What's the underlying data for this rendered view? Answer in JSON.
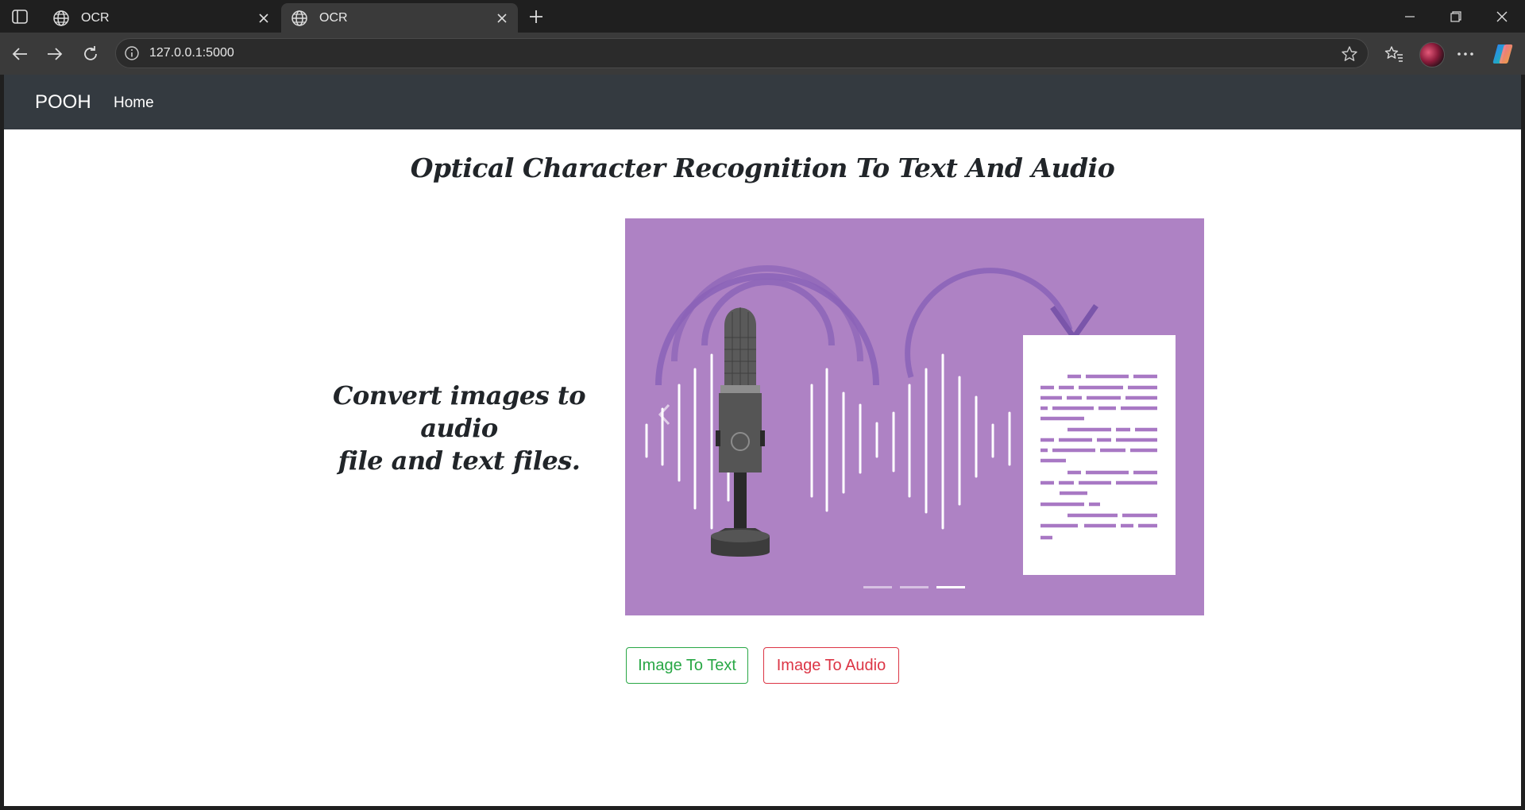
{
  "browser": {
    "tabs": [
      {
        "title": "OCR",
        "active": false
      },
      {
        "title": "OCR",
        "active": true
      }
    ],
    "url": "127.0.0.1:5000",
    "icons": [
      "tab-actions-icon",
      "globe-icon",
      "close-icon",
      "new-tab-icon",
      "minimize-icon",
      "restore-icon",
      "close-window-icon",
      "back-icon",
      "forward-icon",
      "refresh-icon",
      "info-icon",
      "star-icon",
      "favorites-icon",
      "profile-avatar",
      "more-icon",
      "copilot-icon"
    ]
  },
  "navbar": {
    "brand": "POOH",
    "links": [
      {
        "label": "Home"
      }
    ],
    "background": "#343a40"
  },
  "main": {
    "title": "Optical Character Recognition To Text And Audio",
    "tagline_line1": "Convert images to audio",
    "tagline_line2": "file and text files."
  },
  "carousel": {
    "background": "#ae82c4",
    "indicator_count": 3,
    "active_indicator": 3,
    "prev_icon": "chevron-left-icon"
  },
  "buttons": {
    "image_to_text": {
      "label": "Image To Text",
      "color": "#28a745"
    },
    "image_to_audio": {
      "label": "Image To Audio",
      "color": "#dc3545"
    }
  }
}
